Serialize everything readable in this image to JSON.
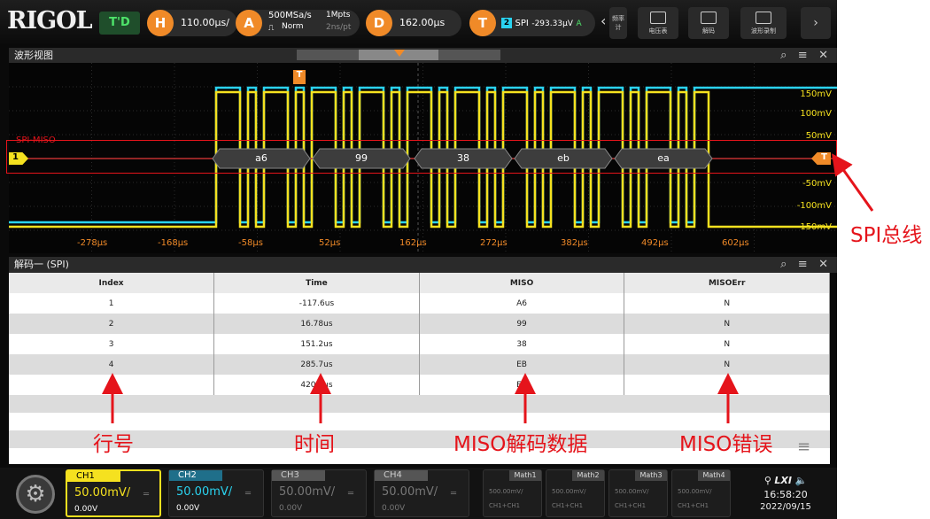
{
  "topbar": {
    "logo": "RIGOL",
    "run_state": "T'D",
    "horizontal_badge": "H",
    "timebase": "110.00μs/",
    "acquire_badge": "A",
    "sample_rate": "500MSa/s",
    "mode": "Norm",
    "mem_depth": "1Mpts",
    "sample_period": "2ns/pt",
    "delay_badge": "D",
    "delay": "162.00μs",
    "trigger_badge": "T",
    "trigger_source": "2",
    "trigger_type": "SPI",
    "trigger_level": "-293.33μV",
    "trigger_mode": "A",
    "btn_counter": "频率计",
    "btn_voltmeter": "电压表",
    "btn_decode": "解码",
    "btn_record": "波形录制"
  },
  "wave_panel": {
    "title": "波形视图",
    "bus_label": "SPI-MISO",
    "ch_marker": "1",
    "trig_marker": "T",
    "bus_values": [
      "a6",
      "99",
      "38",
      "eb",
      "ea"
    ],
    "volt_labels": [
      "150mV",
      "100mV",
      "50mV",
      "-50mV",
      "-100mV",
      "-150mV"
    ],
    "time_labels": [
      "-278μs",
      "-168μs",
      "-58μs",
      "52μs",
      "162μs",
      "272μs",
      "382μs",
      "492μs",
      "602μs"
    ]
  },
  "decode_panel": {
    "title": "解码一 (SPI)",
    "columns": [
      "Index",
      "Time",
      "MISO",
      "MISOErr"
    ],
    "rows": [
      [
        "1",
        "-117.6us",
        "A6",
        "N"
      ],
      [
        "2",
        "16.78us",
        "99",
        "N"
      ],
      [
        "3",
        "151.2us",
        "38",
        "N"
      ],
      [
        "4",
        "285.7us",
        "EB",
        "N"
      ],
      [
        "5",
        "420.1us",
        "EA",
        "N"
      ]
    ]
  },
  "channels": [
    {
      "name": "CH1",
      "scale": "50.00mV/",
      "offset": "0.00V",
      "color": "#f5e11f"
    },
    {
      "name": "CH2",
      "scale": "50.00mV/",
      "offset": "0.00V",
      "color": "#2ad3f0"
    },
    {
      "name": "CH3",
      "scale": "50.00mV/",
      "offset": "0.00V",
      "color": "#777777"
    },
    {
      "name": "CH4",
      "scale": "50.00mV/",
      "offset": "0.00V",
      "color": "#777777"
    }
  ],
  "math": [
    {
      "name": "Math1",
      "scale": "500.00mV/",
      "src": "CH1+CH1"
    },
    {
      "name": "Math2",
      "scale": "500.00mV/",
      "src": "CH1+CH1"
    },
    {
      "name": "Math3",
      "scale": "500.00mV/",
      "src": "CH1+CH1"
    },
    {
      "name": "Math4",
      "scale": "500.00mV/",
      "src": "CH1+CH1"
    }
  ],
  "status": {
    "lxi": "LXI",
    "time": "16:58:20",
    "date": "2022/09/15"
  },
  "annotations": {
    "spi_bus": "SPI总线",
    "row_num": "行号",
    "time": "时间",
    "miso_data": "MISO解码数据",
    "miso_err": "MISO错误"
  },
  "colors": {
    "ch1": "#f5e11f",
    "ch2": "#2ad3f0",
    "bus": "#b0b0b0",
    "trigger": "#f08a28",
    "annotation": "#e5141b"
  }
}
